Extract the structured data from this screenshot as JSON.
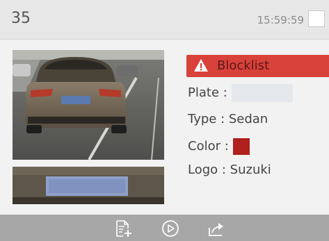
{
  "header": {
    "id": "35",
    "timestamp": "15:59:59"
  },
  "alert": {
    "label": "Blocklist",
    "color": "#d9413b"
  },
  "vehicle": {
    "plate_label": "Plate :",
    "plate_value": "",
    "type_label": "Type :",
    "type_value": "Sedan",
    "type_text": "Type : Sedan",
    "color_label": "Color :",
    "color_swatch": "#b0201c",
    "logo_label": "Logo :",
    "logo_value": "Suzuki",
    "logo_text": "Logo : Suzuki"
  },
  "footer": {
    "buttons": [
      "add-to-list-icon",
      "play-icon",
      "export-icon"
    ]
  }
}
